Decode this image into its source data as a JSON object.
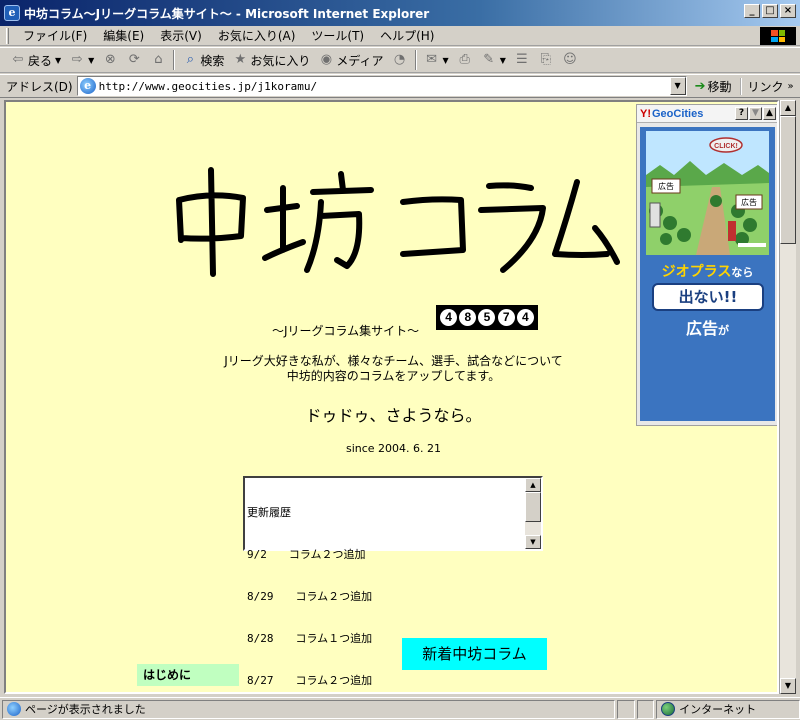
{
  "window": {
    "title": "中坊コラム〜Jリーグコラム集サイト〜 - Microsoft Internet Explorer"
  },
  "menu": {
    "items": [
      "ファイル(F)",
      "編集(E)",
      "表示(V)",
      "お気に入り(A)",
      "ツール(T)",
      "ヘルプ(H)"
    ]
  },
  "toolbar": {
    "back": "戻る",
    "search": "検索",
    "favorites": "お気に入り",
    "media": "メディア"
  },
  "address": {
    "label": "アドレス(D)",
    "url": "http://www.geocities.jp/j1koramu/",
    "go": "移動",
    "links": "リンク"
  },
  "page": {
    "subtitle": "〜Jリーグコラム集サイト〜",
    "counter": [
      "4",
      "8",
      "5",
      "7",
      "4"
    ],
    "desc_line1": "Jリーグ大好きな私が、様々なチーム、選手、試合などについて",
    "desc_line2": "中坊的内容のコラムをアップしてます。",
    "farewell": "ドゥドゥ、さようなら。",
    "since": "since 2004. 6. 21",
    "history": [
      "更新履歴",
      "9/2　　コラム２つ追加",
      "8/29　　コラム２つ追加",
      "8/28　　コラム１つ追加",
      "8/27　　コラム２つ追加"
    ],
    "new_columns": "新着中坊コラム",
    "intro": "はじめに"
  },
  "ad": {
    "yahoo": "Y!",
    "geocities": "GeoCities",
    "help": "?",
    "click": "CLICK!",
    "sign1": "広告",
    "sign2": "広告",
    "line1_main": "ジオプラス",
    "line1_small": "なら",
    "bubble": "出ない!!",
    "line3_main": "広告",
    "line3_small": "が"
  },
  "status": {
    "text": "ページが表示されました",
    "zone": "インターネット"
  },
  "colors": {
    "page_bg": "#ffffc0",
    "new_columns_bg": "#00ffff",
    "intro_bg": "#c0ffc0",
    "ad_bg": "#3b74c0"
  }
}
